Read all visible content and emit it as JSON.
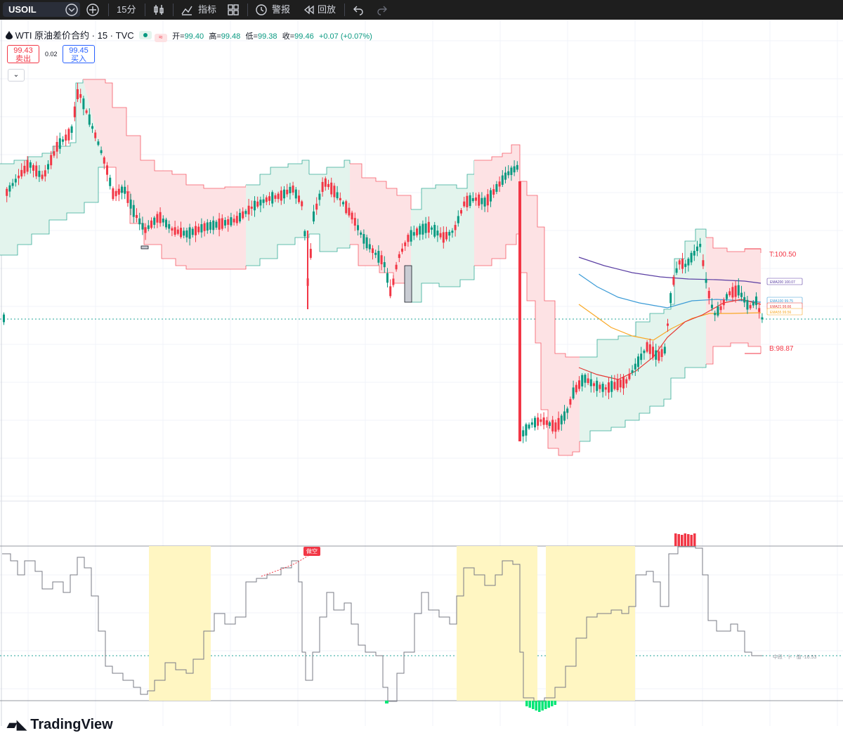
{
  "toolbar": {
    "symbol": "USOIL",
    "interval": "15分",
    "indicators": "指标",
    "alert": "警报",
    "replay": "回放"
  },
  "header": {
    "title": "WTI 原油差价合约 · 15 · TVC",
    "open_label": "开=",
    "open": "99.40",
    "high_label": "高=",
    "high": "99.48",
    "low_label": "低=",
    "low": "99.38",
    "close_label": "收=",
    "close": "99.46",
    "change": "+0.07 (+0.07%)"
  },
  "trade": {
    "sell_price": "99.43",
    "sell_label": "卖出",
    "spread": "0.02",
    "buy_price": "99.45",
    "buy_label": "买入"
  },
  "labels": {
    "top_target": "T:100.50",
    "bottom_target": "B:98.87",
    "ema200": "EMA200 100.07",
    "ema100": "EMA100 99.75",
    "ema21": "EMA21 99.66",
    "ema55": "EMA55 99.56",
    "signal": "做空",
    "osc_readout": "中段 · 卜 · 值 -16.53"
  },
  "watermark": "TradingView",
  "colors": {
    "up": "#089981",
    "down": "#f23645",
    "red_band": "#fde2e4",
    "green_band": "#e3f4ed",
    "ema200": "#5b3fa3",
    "ema100": "#3b9bd6",
    "ema21": "#e53935",
    "ema55": "#f9a825",
    "highlight": "#fff6c2"
  }
}
